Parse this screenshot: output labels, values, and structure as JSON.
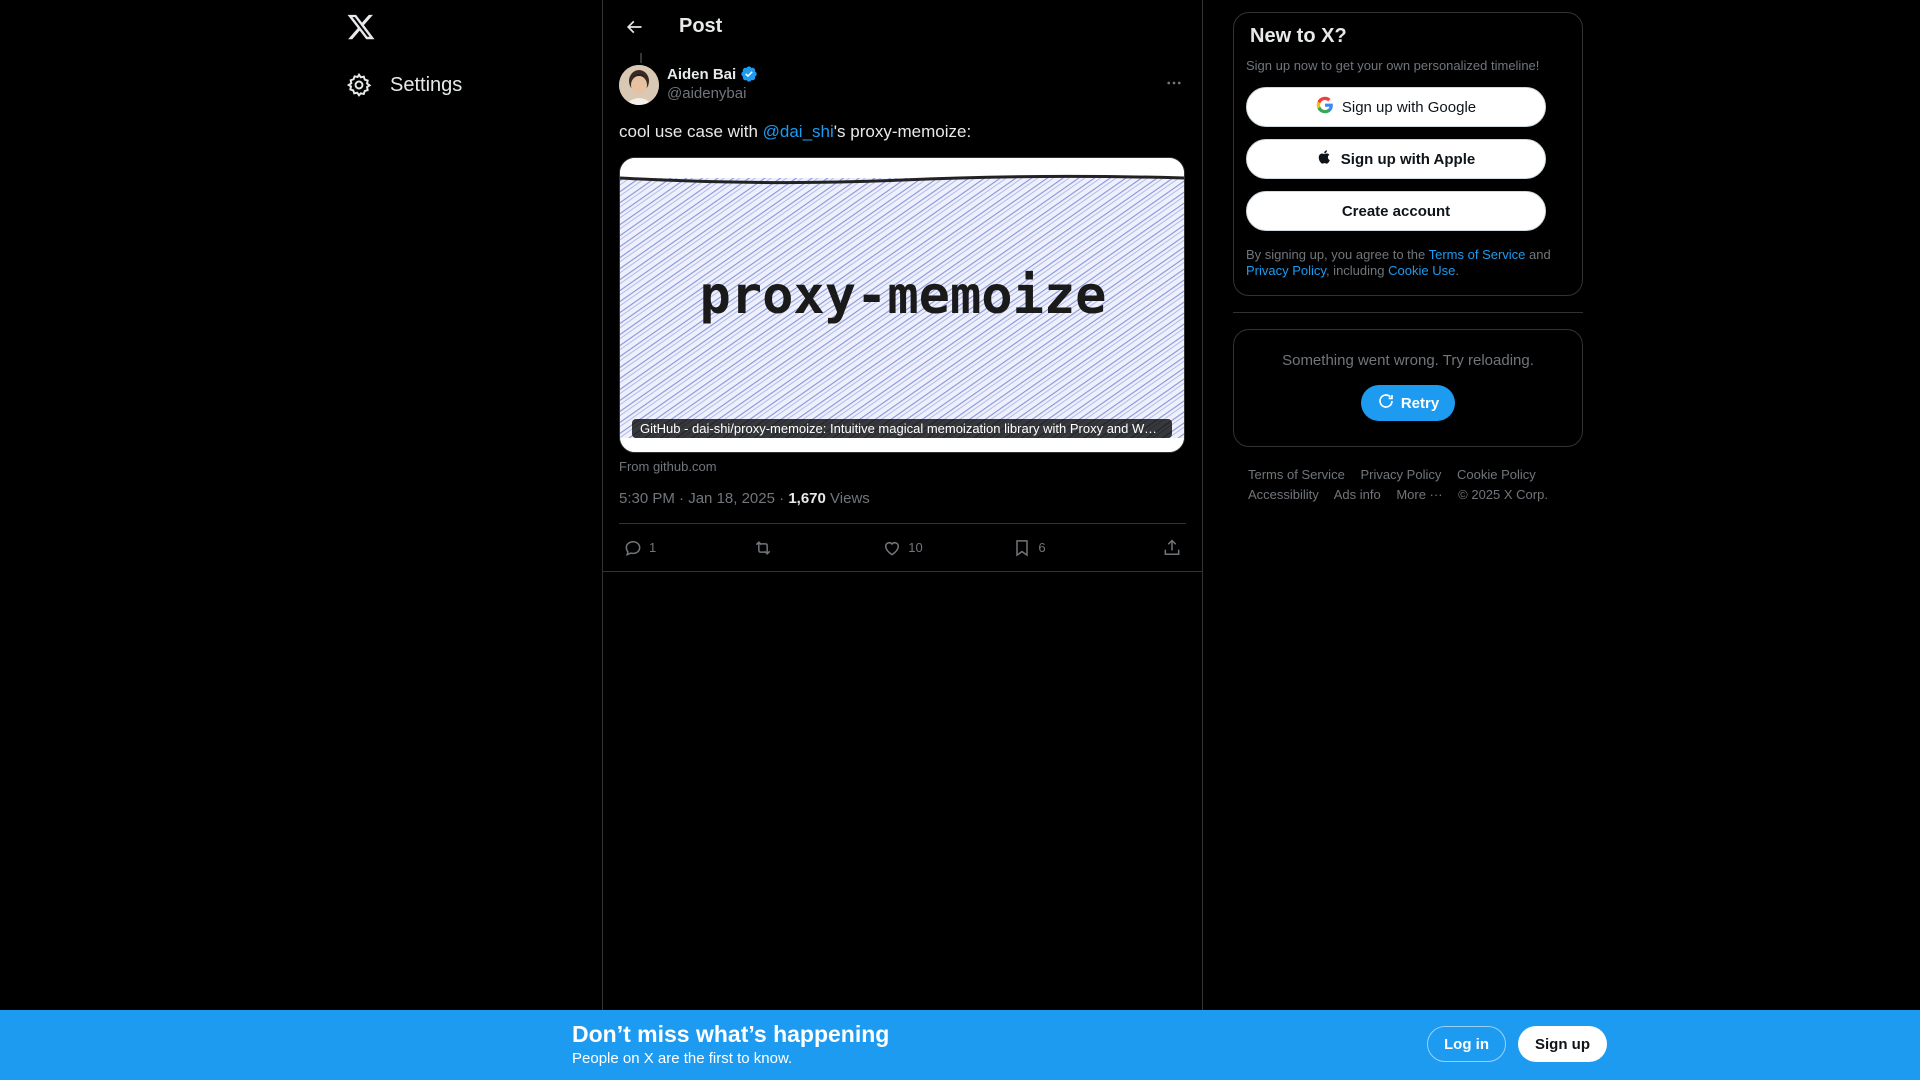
{
  "nav": {
    "logo_icon": "x-logo-icon",
    "settings_label": "Settings"
  },
  "post_header": {
    "title": "Post"
  },
  "tweet": {
    "author_name": "Aiden Bai",
    "handle": "@aidenybai",
    "text_before": "cool use case with ",
    "mention": "@dai_shi",
    "text_after": "'s proxy-memoize:",
    "card_image_text": "proxy-memoize",
    "card_caption": "GitHub - dai-shi/proxy-memoize: Intuitive magical memoization library with Proxy and WeakMap",
    "card_source": "From github.com",
    "time": "5:30 PM",
    "date": "Jan 18, 2025",
    "views_count": "1,670",
    "views_label": "Views",
    "replies": "1",
    "retweets": "",
    "likes": "10",
    "bookmarks": "6"
  },
  "signup": {
    "title": "New to X?",
    "subtitle": "Sign up now to get your own personalized timeline!",
    "google_label": "Sign up with Google",
    "apple_label": "Sign up with Apple",
    "create_label": "Create account",
    "terms_prefix": "By signing up, you agree to the ",
    "terms_link": "Terms of Service",
    "terms_and": " and ",
    "privacy_link": "Privacy Policy",
    "terms_including": ", including ",
    "cookie_link": "Cookie Use",
    "terms_end": "."
  },
  "error": {
    "text": "Something went wrong. Try reloading.",
    "retry_label": "Retry"
  },
  "footer": {
    "terms": "Terms of Service",
    "privacy": "Privacy Policy",
    "cookie": "Cookie Policy",
    "accessibility": "Accessibility",
    "ads": "Ads info",
    "more": "More ···",
    "copyright": "© 2025 X Corp."
  },
  "banner": {
    "title": "Don’t miss what’s happening",
    "subtitle": "People on X are the first to know.",
    "login_label": "Log in",
    "signup_label": "Sign up"
  },
  "colors": {
    "accent": "#1d9bf0",
    "background": "#000000",
    "border": "#2f3336",
    "muted_text": "#71767b"
  }
}
